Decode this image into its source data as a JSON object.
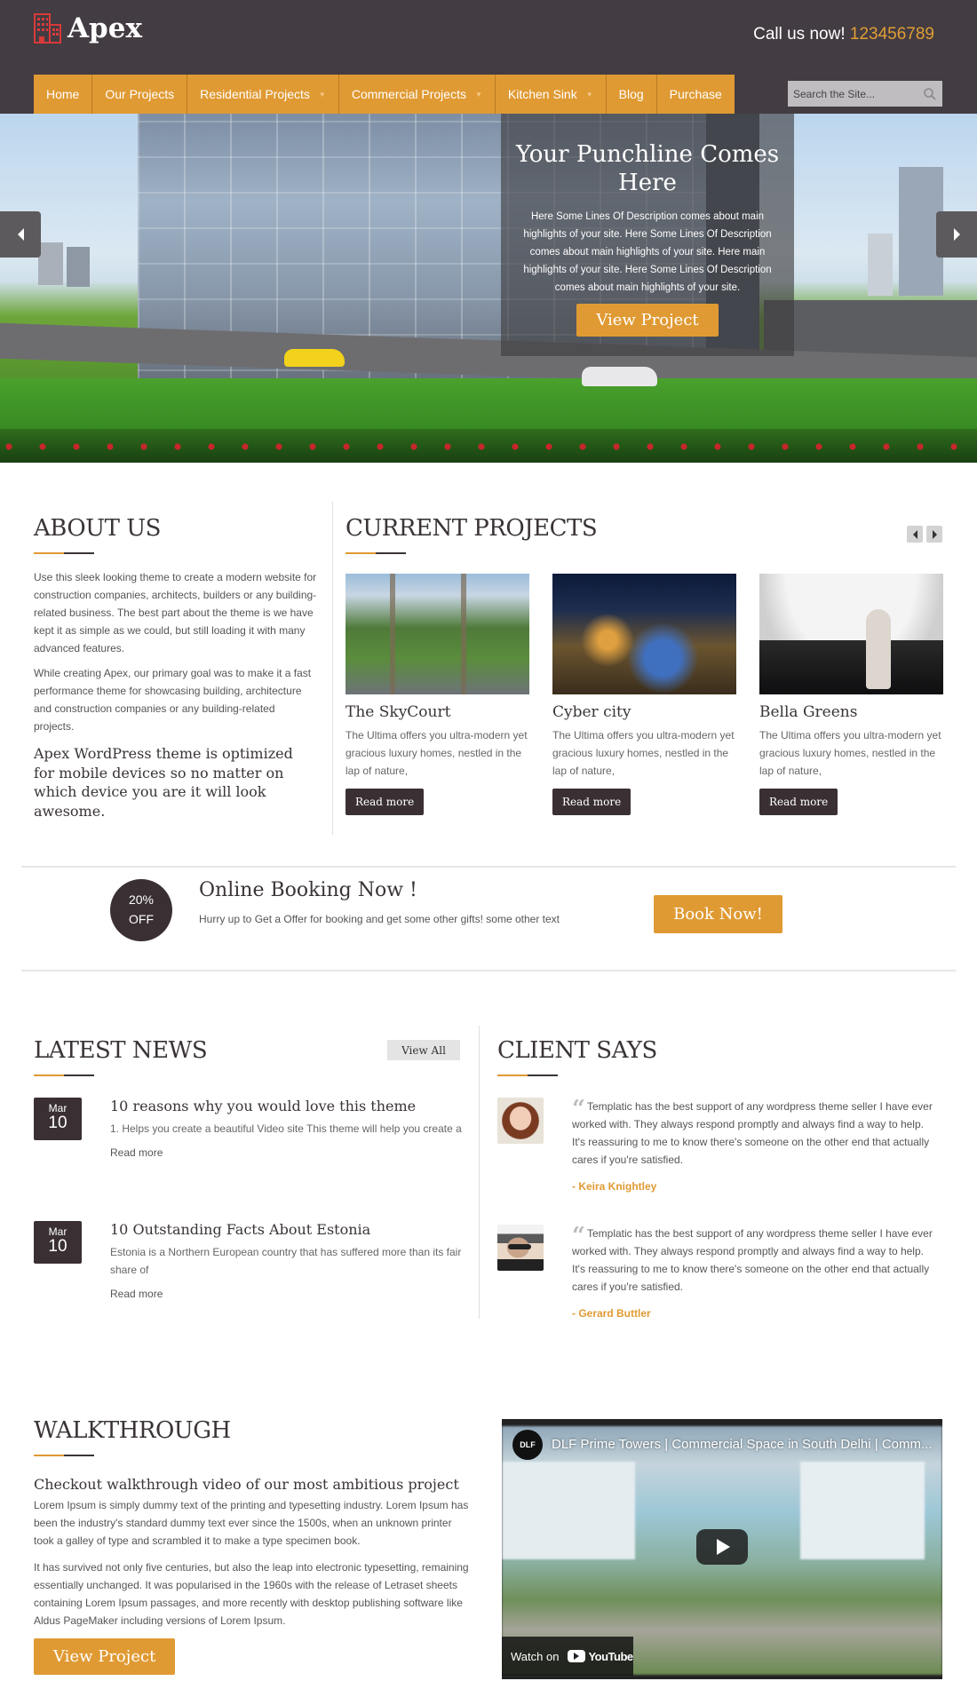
{
  "header": {
    "logo_text": "Apex",
    "call_label": "Call us now!",
    "phone": "123456789",
    "search_placeholder": "Search the Site...",
    "nav": [
      {
        "label": "Home",
        "has_dropdown": false
      },
      {
        "label": "Our Projects",
        "has_dropdown": false
      },
      {
        "label": "Residential Projects",
        "has_dropdown": true
      },
      {
        "label": "Commercial Projects",
        "has_dropdown": true
      },
      {
        "label": "Kitchen Sink",
        "has_dropdown": true
      },
      {
        "label": "Blog",
        "has_dropdown": false
      },
      {
        "label": "Purchase",
        "has_dropdown": false
      }
    ]
  },
  "hero": {
    "title": "Your Punchline Comes Here",
    "description": "Here Some Lines Of Description comes about main highlights of your site. Here Some Lines Of Description comes about main highlights of your site. Here main highlights of your site. Here Some Lines Of Description comes about main highlights of your site.",
    "button": "View Project"
  },
  "about": {
    "title": "ABOUT US",
    "p1": "Use this sleek looking theme to create a modern website for construction companies, architects, builders or any building-related business. The best part about the theme is we have kept it as simple as we could, but still loading it with many advanced features.",
    "p2": "While creating Apex, our primary goal was to make it a fast performance theme for showcasing building, architecture and construction companies or any building-related projects.",
    "highlight": "Apex WordPress theme is optimized for mobile devices so no matter on which device you are it will look awesome."
  },
  "projects": {
    "title": "CURRENT PROJECTS",
    "items": [
      {
        "name": "The SkyCourt",
        "desc": "The Ultima offers you ultra-modern yet gracious luxury homes, nestled in the lap of nature,",
        "button": "Read more"
      },
      {
        "name": "Cyber city",
        "desc": "The Ultima offers you ultra-modern yet gracious luxury homes, nestled in the lap of nature,",
        "button": "Read more"
      },
      {
        "name": "Bella Greens",
        "desc": "The Ultima offers you ultra-modern yet gracious luxury homes, nestled in the lap of nature,",
        "button": "Read more"
      }
    ]
  },
  "booking": {
    "badge_line1": "20%",
    "badge_line2": "OFF",
    "title": "Online Booking Now !",
    "subtitle": "Hurry up to Get a Offer for booking and get some other gifts! some other text",
    "button": "Book Now!"
  },
  "news": {
    "title": "LATEST NEWS",
    "view_all": "View All",
    "items": [
      {
        "month": "Mar",
        "day": "10",
        "title": "10 reasons why you would love this theme",
        "excerpt": "1. Helps you create a beautiful Video site This theme will help you create a",
        "more": "Read more"
      },
      {
        "month": "Mar",
        "day": "10",
        "title": "10 Outstanding Facts About Estonia",
        "excerpt": "Estonia is a Northern European country that has suffered more than its fair share of",
        "more": "Read more"
      }
    ]
  },
  "clients": {
    "title": "CLIENT SAYS",
    "items": [
      {
        "quote": "Templatic has the best support of any wordpress theme seller I have ever worked with. They always respond promptly and always find a way to help. It's reassuring to me to know there's someone on the other end that actually cares if you're satisfied.",
        "name": "- Keira Knightley"
      },
      {
        "quote": "Templatic has the best support of any wordpress theme seller I have ever worked with. They always respond promptly and always find a way to help. It's reassuring to me to know there's someone on the other end that actually cares if you're satisfied.",
        "name": "- Gerard Buttler"
      }
    ]
  },
  "walkthrough": {
    "title": "WALKTHROUGH",
    "subtitle": "Checkout walkthrough video of our most ambitious project",
    "p1": "Lorem Ipsum is simply dummy text of the printing and typesetting industry. Lorem Ipsum has been the industry's standard dummy text ever since the 1500s, when an unknown printer took a galley of type and scrambled it to make a type specimen book.",
    "p2": "It has survived not only five centuries, but also the leap into electronic typesetting, remaining essentially unchanged. It was popularised in the 1960s with the release of Letraset sheets containing Lorem Ipsum passages, and more recently with desktop publishing software like Aldus PageMaker including versions of Lorem Ipsum.",
    "button": "View Project",
    "video": {
      "channel_logo": "DLF",
      "title": "DLF Prime Towers | Commercial Space in South Delhi | Comm...",
      "watch_on": "Watch on",
      "platform": "YouTube"
    }
  },
  "colors": {
    "accent": "#e09a33",
    "header_bg": "#433c42",
    "dark": "#3a3034"
  }
}
